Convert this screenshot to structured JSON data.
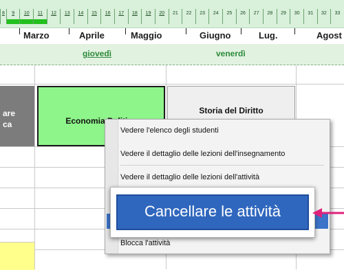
{
  "weeks": [
    "8",
    "9",
    "10",
    "11",
    "12",
    "13",
    "14",
    "15",
    "16",
    "17",
    "18",
    "19",
    "20",
    "21",
    "22",
    "23",
    "24",
    "25",
    "26",
    "27",
    "28",
    "29",
    "30",
    "31",
    "32",
    "33"
  ],
  "months": [
    "Marzo",
    "Aprile",
    "Maggio",
    "Giugno",
    "Lug.",
    "Agost"
  ],
  "days": {
    "left": "giovedì",
    "right": "venerdì"
  },
  "grid": {
    "left_cell_text": "are\nca",
    "cell_eco": "Economia Politica",
    "cell_storia": "Storia del Diritto"
  },
  "context_menu": {
    "items": [
      "Vedere l'elenco degli studenti",
      "Vedere il dettaglio delle lezioni dell'insegnamento",
      "Vedere il dettaglio delle lezioni dell'attività",
      "Cancellare le attività",
      "Blocca l'attività"
    ],
    "highlighted": "Cancellare le attività"
  },
  "callout": {
    "text": "Cancellare le attività",
    "arrow_color": "#e0217a"
  },
  "colors": {
    "header_green": "#d9f0db",
    "week_selected": "#23c01e",
    "course_green": "#8ef58a",
    "highlight_blue": "#3067be",
    "yellow_cell": "#ffff8c"
  }
}
